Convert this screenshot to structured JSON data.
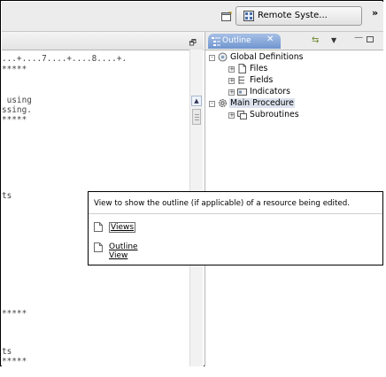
{
  "toolbar": {
    "perspective_button": "Remote Syste...",
    "overflow_chevron": "»"
  },
  "editor": {
    "ruler": "...+....7....+....8....+.",
    "lines": [
      "*****",
      "",
      " using",
      "ssing.",
      "*****",
      "",
      "",
      "",
      "",
      "ts",
      "",
      "",
      "",
      "",
      "",
      "",
      "",
      "",
      "",
      "",
      "",
      "",
      "*****",
      "",
      "",
      "",
      "ts",
      "*****"
    ]
  },
  "outline": {
    "tab_label": "Outline",
    "tree": [
      {
        "label": "Global Definitions",
        "level": 0,
        "expander": "-",
        "icon": "globe-gear-icon"
      },
      {
        "label": "Files",
        "level": 1,
        "expander": "+",
        "icon": "file-icon"
      },
      {
        "label": "Fields",
        "level": 1,
        "expander": "+",
        "icon": "fields-icon"
      },
      {
        "label": "Indicators",
        "level": 1,
        "expander": "+",
        "icon": "indicators-icon"
      },
      {
        "label": "Main Procedure",
        "level": 0,
        "expander": "-",
        "icon": "gear-icon"
      },
      {
        "label": "Subroutines",
        "level": 1,
        "expander": "+",
        "icon": "subroutines-icon"
      }
    ]
  },
  "tooltip": {
    "title": "View to show the outline (if applicable) of a resource being edited.",
    "links": [
      {
        "label": "Views",
        "icon": "page-icon"
      },
      {
        "label": "Outline View",
        "icon": "page-icon"
      }
    ]
  }
}
